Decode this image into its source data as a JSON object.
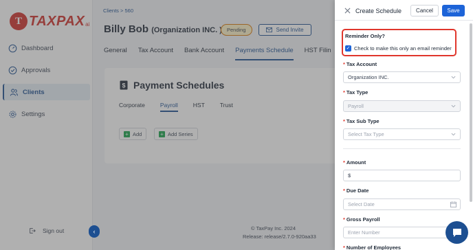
{
  "sidebar": {
    "logo_mark": "T",
    "logo_text": "TAXPAX",
    "logo_sub": "ai",
    "items": [
      {
        "label": "Dashboard",
        "icon": "dashboard-icon"
      },
      {
        "label": "Approvals",
        "icon": "check-circle-icon"
      },
      {
        "label": "Clients",
        "icon": "users-icon"
      },
      {
        "label": "Settings",
        "icon": "gear-icon"
      }
    ],
    "active_item": "Clients",
    "signout_label": "Sign out"
  },
  "main": {
    "breadcrumb": "Clients > 560",
    "client_name": "Billy Bob",
    "org_name": "(Organization INC. )",
    "status_badge": "Pending",
    "invite_button": "Send Invite",
    "tabs": [
      "General",
      "Tax Account",
      "Bank Account",
      "Payments Schedule",
      "HST Filin"
    ],
    "active_tab": "Payments Schedule",
    "card": {
      "title": "Payment Schedules",
      "subtabs": [
        "Corporate",
        "Payroll",
        "HST",
        "Trust"
      ],
      "active_subtab": "Payroll",
      "add_button": "Add",
      "add_series_button": "Add Series"
    },
    "footer_copy": "© TaxPay Inc. 2024",
    "footer_release": "Release: release/2.7.0-920aa33"
  },
  "drawer": {
    "title": "Create Schedule",
    "cancel_button": "Cancel",
    "save_button": "Save",
    "reminder": {
      "title": "Reminder Only?",
      "checkbox_label": "Check to make this only an email reminder",
      "checked": true
    },
    "fields": {
      "tax_account": {
        "label": "Tax Account",
        "value": "Organization INC."
      },
      "tax_type": {
        "label": "Tax Type",
        "value": "Payroll"
      },
      "tax_sub_type": {
        "label": "Tax Sub Type",
        "placeholder": "Select Tax Type"
      },
      "amount": {
        "label": "Amount",
        "value": "$"
      },
      "due_date": {
        "label": "Due Date",
        "placeholder": "Select Date"
      },
      "gross_payroll": {
        "label": "Gross Payroll",
        "placeholder": "Enter Number"
      },
      "num_employees": {
        "label": "Number of Employees"
      }
    }
  },
  "colors": {
    "brand_red": "#d0302b",
    "primary_blue": "#1d4f91",
    "save_blue": "#1d64d8",
    "highlight_red": "#e0362c"
  }
}
